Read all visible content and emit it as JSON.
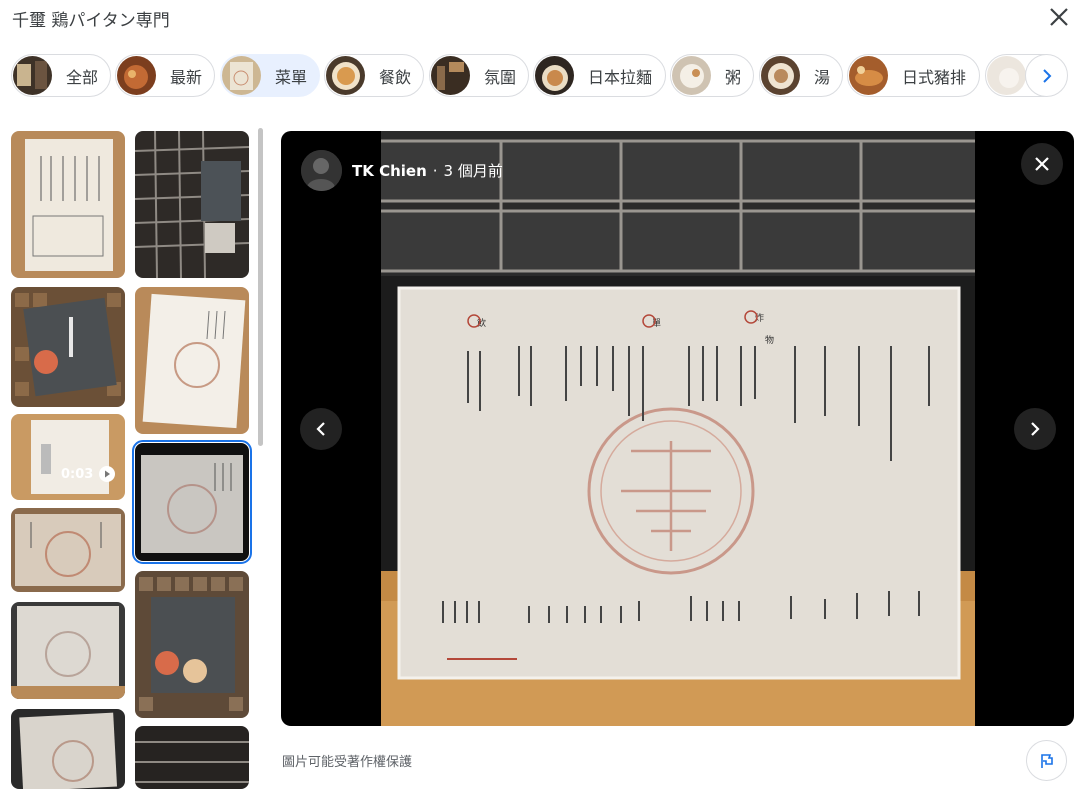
{
  "header": {
    "title": "千璽 鶏パイタン専門"
  },
  "chips": [
    {
      "label": "全部",
      "thumb_color": "#4a3b2e",
      "icon": "thumb-icon"
    },
    {
      "label": "最新",
      "thumb_color": "#a8542b",
      "icon": "thumb-icon"
    },
    {
      "label": "菜單",
      "thumb_color": "#d9c7a4",
      "icon": "thumb-icon",
      "active": true
    },
    {
      "label": "餐飲",
      "thumb_color": "#d79a52",
      "icon": "thumb-icon"
    },
    {
      "label": "氛圍",
      "thumb_color": "#5a4634",
      "icon": "thumb-icon"
    },
    {
      "label": "日本拉麵",
      "thumb_color": "#c9a07a",
      "icon": "thumb-icon"
    },
    {
      "label": "粥",
      "thumb_color": "#e2d7c6",
      "icon": "thumb-icon"
    },
    {
      "label": "湯",
      "thumb_color": "#8b6a48",
      "icon": "thumb-icon"
    },
    {
      "label": "日式豬排",
      "thumb_color": "#b56a35",
      "icon": "thumb-icon"
    },
    {
      "label": "",
      "thumb_color": "#e8e3dc",
      "icon": "thumb-icon"
    }
  ],
  "viewer": {
    "author": "TK Chien",
    "time": "3 個月前",
    "separator": "·"
  },
  "thumbs": {
    "video_duration": "0:03"
  },
  "footer": {
    "copyright": "圖片可能受著作權保護"
  },
  "colors": {
    "accent": "#1a73e8",
    "active_chip_bg": "#e8f0fe"
  }
}
